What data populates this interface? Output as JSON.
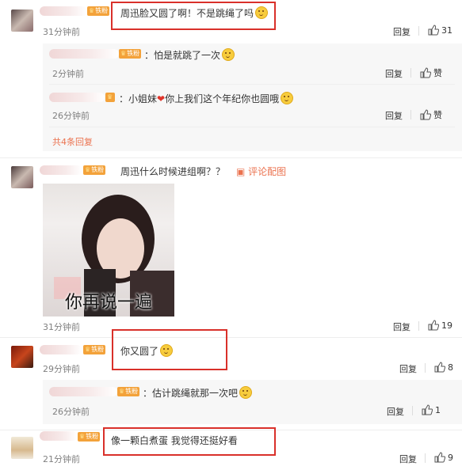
{
  "comments": [
    {
      "text": "周迅脸又圆了啊！不是跳绳了吗",
      "time": "31分钟前",
      "reply": "回复",
      "likes": "31"
    },
    {
      "text": "周迅什么时候进组啊？？",
      "action": "评论配图",
      "time": "31分钟前",
      "reply": "回复",
      "likes": "19",
      "meme_caption": "你再说一遍"
    },
    {
      "text": "你又圆了",
      "time": "29分钟前",
      "reply": "回复",
      "likes": "8"
    },
    {
      "text": "像一颗白煮蛋 我觉得还挺好看",
      "time": "21分钟前",
      "reply": "回复",
      "likes": "9"
    }
  ],
  "replies_1": [
    {
      "text": "：怕是就跳了一次",
      "time": "2分钟前",
      "reply": "回复",
      "likes": "赞"
    },
    {
      "text": "：小姐妹",
      "text2": "你上我们这个年纪你也圆哦",
      "time": "26分钟前",
      "reply": "回复",
      "likes": "赞"
    }
  ],
  "more_replies": "共4条回复",
  "replies_3": [
    {
      "text": "：估计跳绳就那一次吧",
      "time": "26分钟前",
      "reply": "回复",
      "likes": "1"
    }
  ],
  "fan_badge": "铁粉",
  "colors": {
    "highlight": "#d9302a",
    "link": "#eb7350",
    "badge": "#f3a23a"
  }
}
